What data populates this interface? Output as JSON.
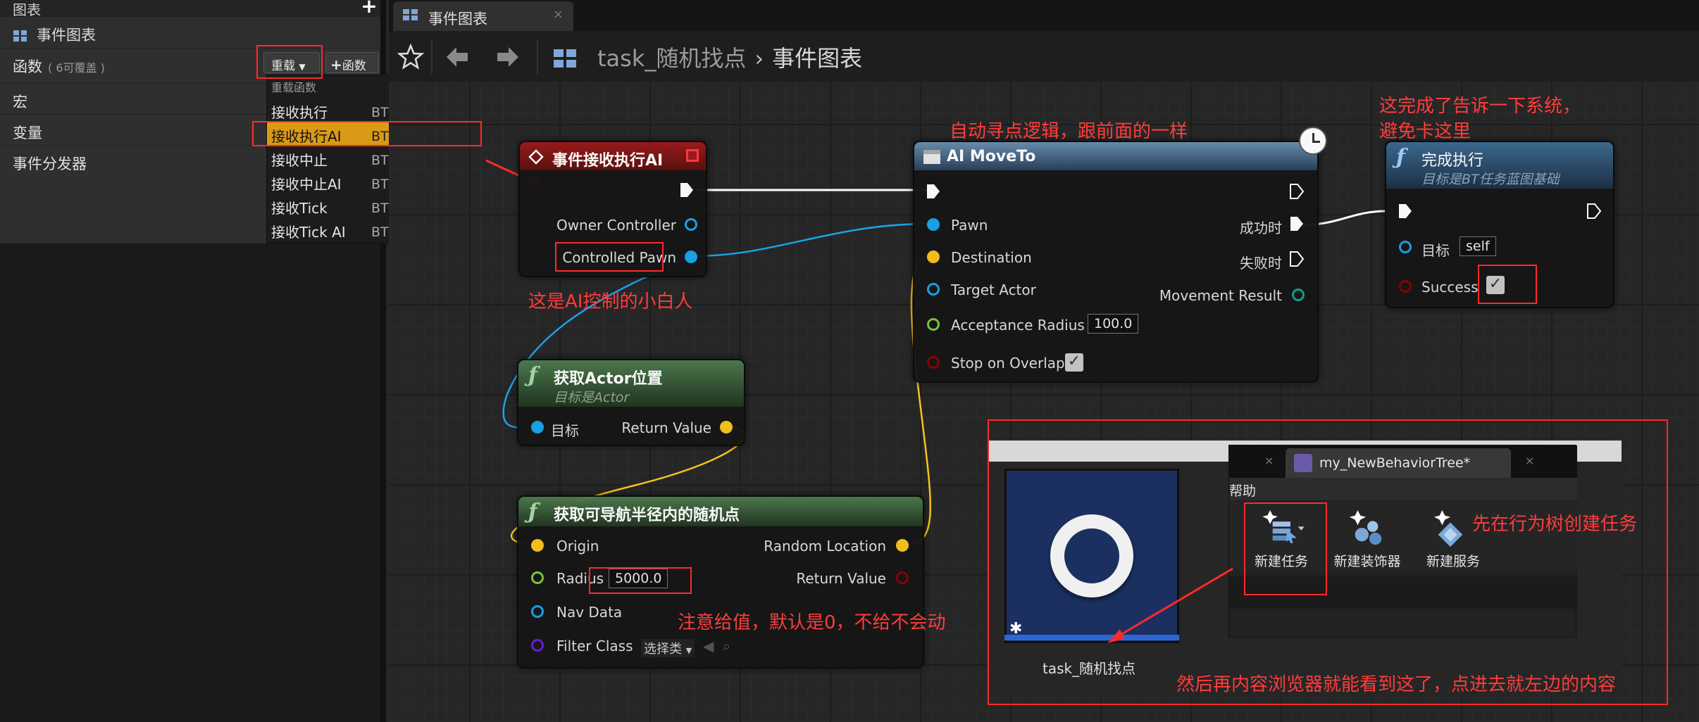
{
  "left_panel": {
    "header": "图表",
    "graph_item": "事件图表",
    "functions": {
      "label": "函数",
      "sub": "( 6可覆盖 )",
      "override_btn": "重载",
      "add_btn": "函数"
    },
    "macros": "宏",
    "variables": "变量",
    "dispatchers": "事件分发器"
  },
  "dropdown": {
    "header": "重载函数",
    "items": [
      {
        "name": "接收执行",
        "category": "BT任务蓝图基础"
      },
      {
        "name": "接收执行AI",
        "category": "BT任务蓝图基础"
      },
      {
        "name": "接收中止",
        "category": "BT任务蓝图基础"
      },
      {
        "name": "接收中止AI",
        "category": "BT任务蓝图基础"
      },
      {
        "name": "接收Tick",
        "category": "BT任务蓝图基础"
      },
      {
        "name": "接收Tick AI",
        "category": "BT任务蓝图基础"
      }
    ],
    "selected_index": 1
  },
  "tab": {
    "label": "事件图表",
    "close": "×"
  },
  "breadcrumb": {
    "root": "task_随机找点",
    "sep": "›",
    "current": "事件图表"
  },
  "nodes": {
    "event": {
      "title": "事件接收执行AI",
      "pins": {
        "owner": "Owner Controller",
        "pawn": "Controlled Pawn"
      }
    },
    "getloc": {
      "title": "获取Actor位置",
      "sub": "目标是Actor",
      "target": "目标",
      "ret": "Return Value"
    },
    "random": {
      "title": "获取可导航半径内的随机点",
      "origin": "Origin",
      "radius": "Radius",
      "radius_val": "5000.0",
      "navdata": "Nav Data",
      "filter": "Filter Class",
      "filter_val": "选择类",
      "rand_loc": "Random Location",
      "ret": "Return Value"
    },
    "moveto": {
      "title": "AI MoveTo",
      "pawn": "Pawn",
      "dest": "Destination",
      "target": "Target Actor",
      "acc": "Acceptance Radius",
      "acc_val": "100.0",
      "stop": "Stop on Overlap",
      "success": "成功时",
      "fail": "失败时",
      "result": "Movement Result"
    },
    "finish": {
      "title": "完成执行",
      "sub": "目标是BT任务蓝图基础",
      "target": "目标",
      "target_val": "self",
      "success": "Success"
    }
  },
  "annotations": {
    "a1": "自动寻点逻辑，跟前面的一样",
    "a2": "这完成了告诉一下系统，",
    "a3": "避免卡这里",
    "a4": "这是AI控制的小白人",
    "a5": "注意给值，默认是0，不给不会动",
    "a6": "先在行为树创建任务",
    "a7": "然后再内容浏览器就能看到这了，点进去就左边的内容"
  },
  "inset": {
    "asset_name": "task_随机找点",
    "bt_tab": "my_NewBehaviorTree*",
    "menu_help": "帮助",
    "btn_new_task": "新建任务",
    "btn_new_decorator": "新建装饰器",
    "btn_new_service": "新建服务"
  },
  "colors": {
    "exec": "#ffffff",
    "object": "#1aa3e8",
    "vector": "#f8c21c",
    "float": "#7cc83c",
    "bool": "#8e0000",
    "struct": "#0aa38f",
    "class": "#6a1fd6",
    "annotation": "#ff3c3c",
    "highlight": "#d99a16"
  }
}
